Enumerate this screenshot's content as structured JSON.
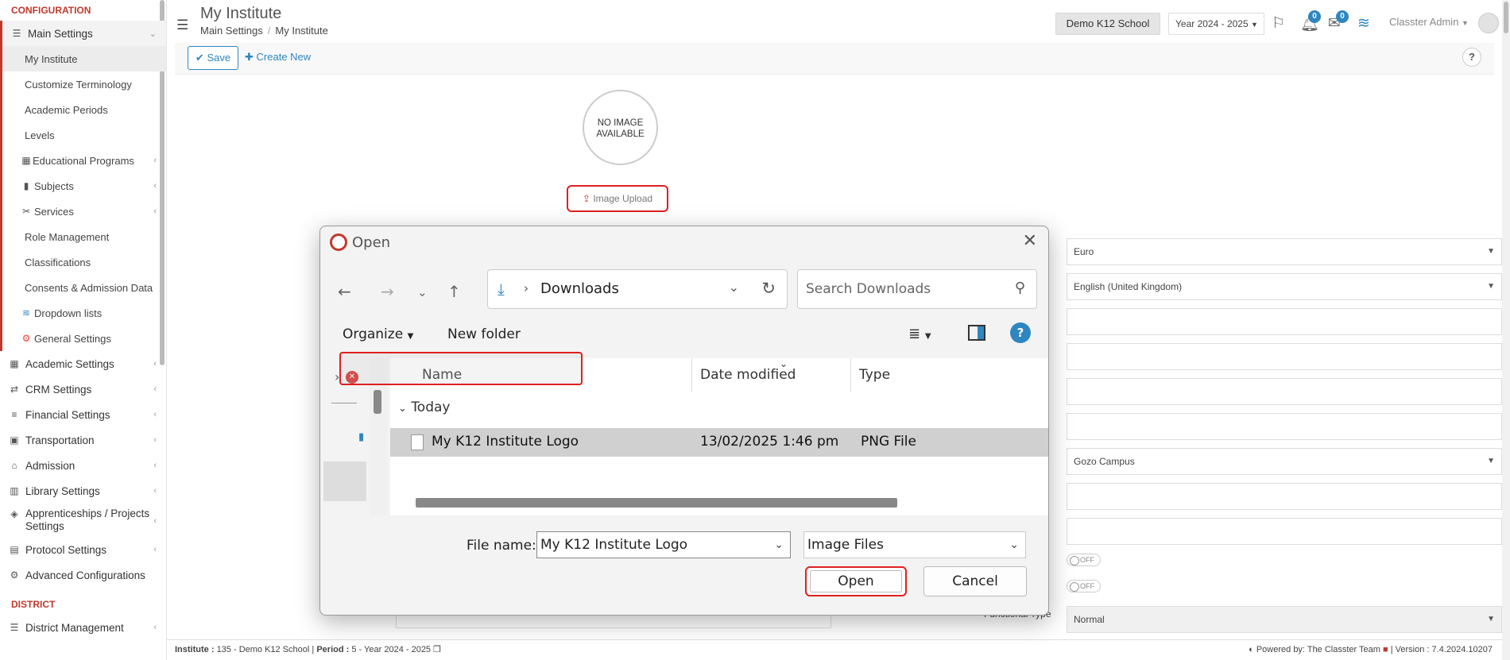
{
  "sidebar": {
    "section_config": "CONFIGURATION",
    "main_settings": "Main Settings",
    "sub_items": [
      "My Institute",
      "Customize Terminology",
      "Academic Periods",
      "Levels",
      "Educational Programs",
      "Subjects",
      "Services",
      "Role Management",
      "Classifications",
      "Consents & Admission Data",
      "Dropdown lists",
      "General Settings"
    ],
    "top_items": [
      "Academic Settings",
      "CRM Settings",
      "Financial Settings",
      "Transportation",
      "Admission",
      "Library Settings",
      "Apprenticeships / Projects Settings",
      "Protocol Settings",
      "Advanced Configurations"
    ],
    "section_district": "DISTRICT",
    "district_item": "District Management"
  },
  "header": {
    "title": "My Institute",
    "breadcrumb": [
      "Main Settings",
      "My Institute"
    ],
    "school": "Demo K12 School",
    "year": "Year 2024 - 2025",
    "notif_count": "0",
    "mail_count": "0",
    "user": "Classter Admin"
  },
  "toolbar": {
    "save": "Save",
    "create_new": "Create New",
    "help": "?"
  },
  "content": {
    "no_image": "NO IMAGE AVAILABLE",
    "image_upload": "Image Upload",
    "fields": [
      "Euro",
      "English (United Kingdom)",
      "",
      "",
      "",
      "",
      "Gozo Campus",
      "",
      ""
    ],
    "toggle1": "OFF",
    "toggle2": "OFF",
    "functional_type_label": "Functional Type",
    "functional_type_value": "Normal"
  },
  "footer": {
    "institute_label": "Institute :",
    "institute": "135 - Demo K12 School",
    "period_label": "Period :",
    "period": "5 - Year 2024 - 2025",
    "powered": "Powered by: The Classter Team",
    "version": "Version : 7.4.2024.10207"
  },
  "dialog": {
    "title": "Open",
    "path": "Downloads",
    "search_placeholder": "Search Downloads",
    "organize": "Organize",
    "new_folder": "New folder",
    "col_name": "Name",
    "col_date": "Date modified",
    "col_type": "Type",
    "group": "Today",
    "file": {
      "name": "My K12 Institute Logo",
      "date": "13/02/2025 1:46 pm",
      "type": "PNG File"
    },
    "file_name_label": "File name:",
    "file_name_value": "My K12 Institute Logo",
    "filter": "Image Files",
    "open": "Open",
    "cancel": "Cancel"
  }
}
